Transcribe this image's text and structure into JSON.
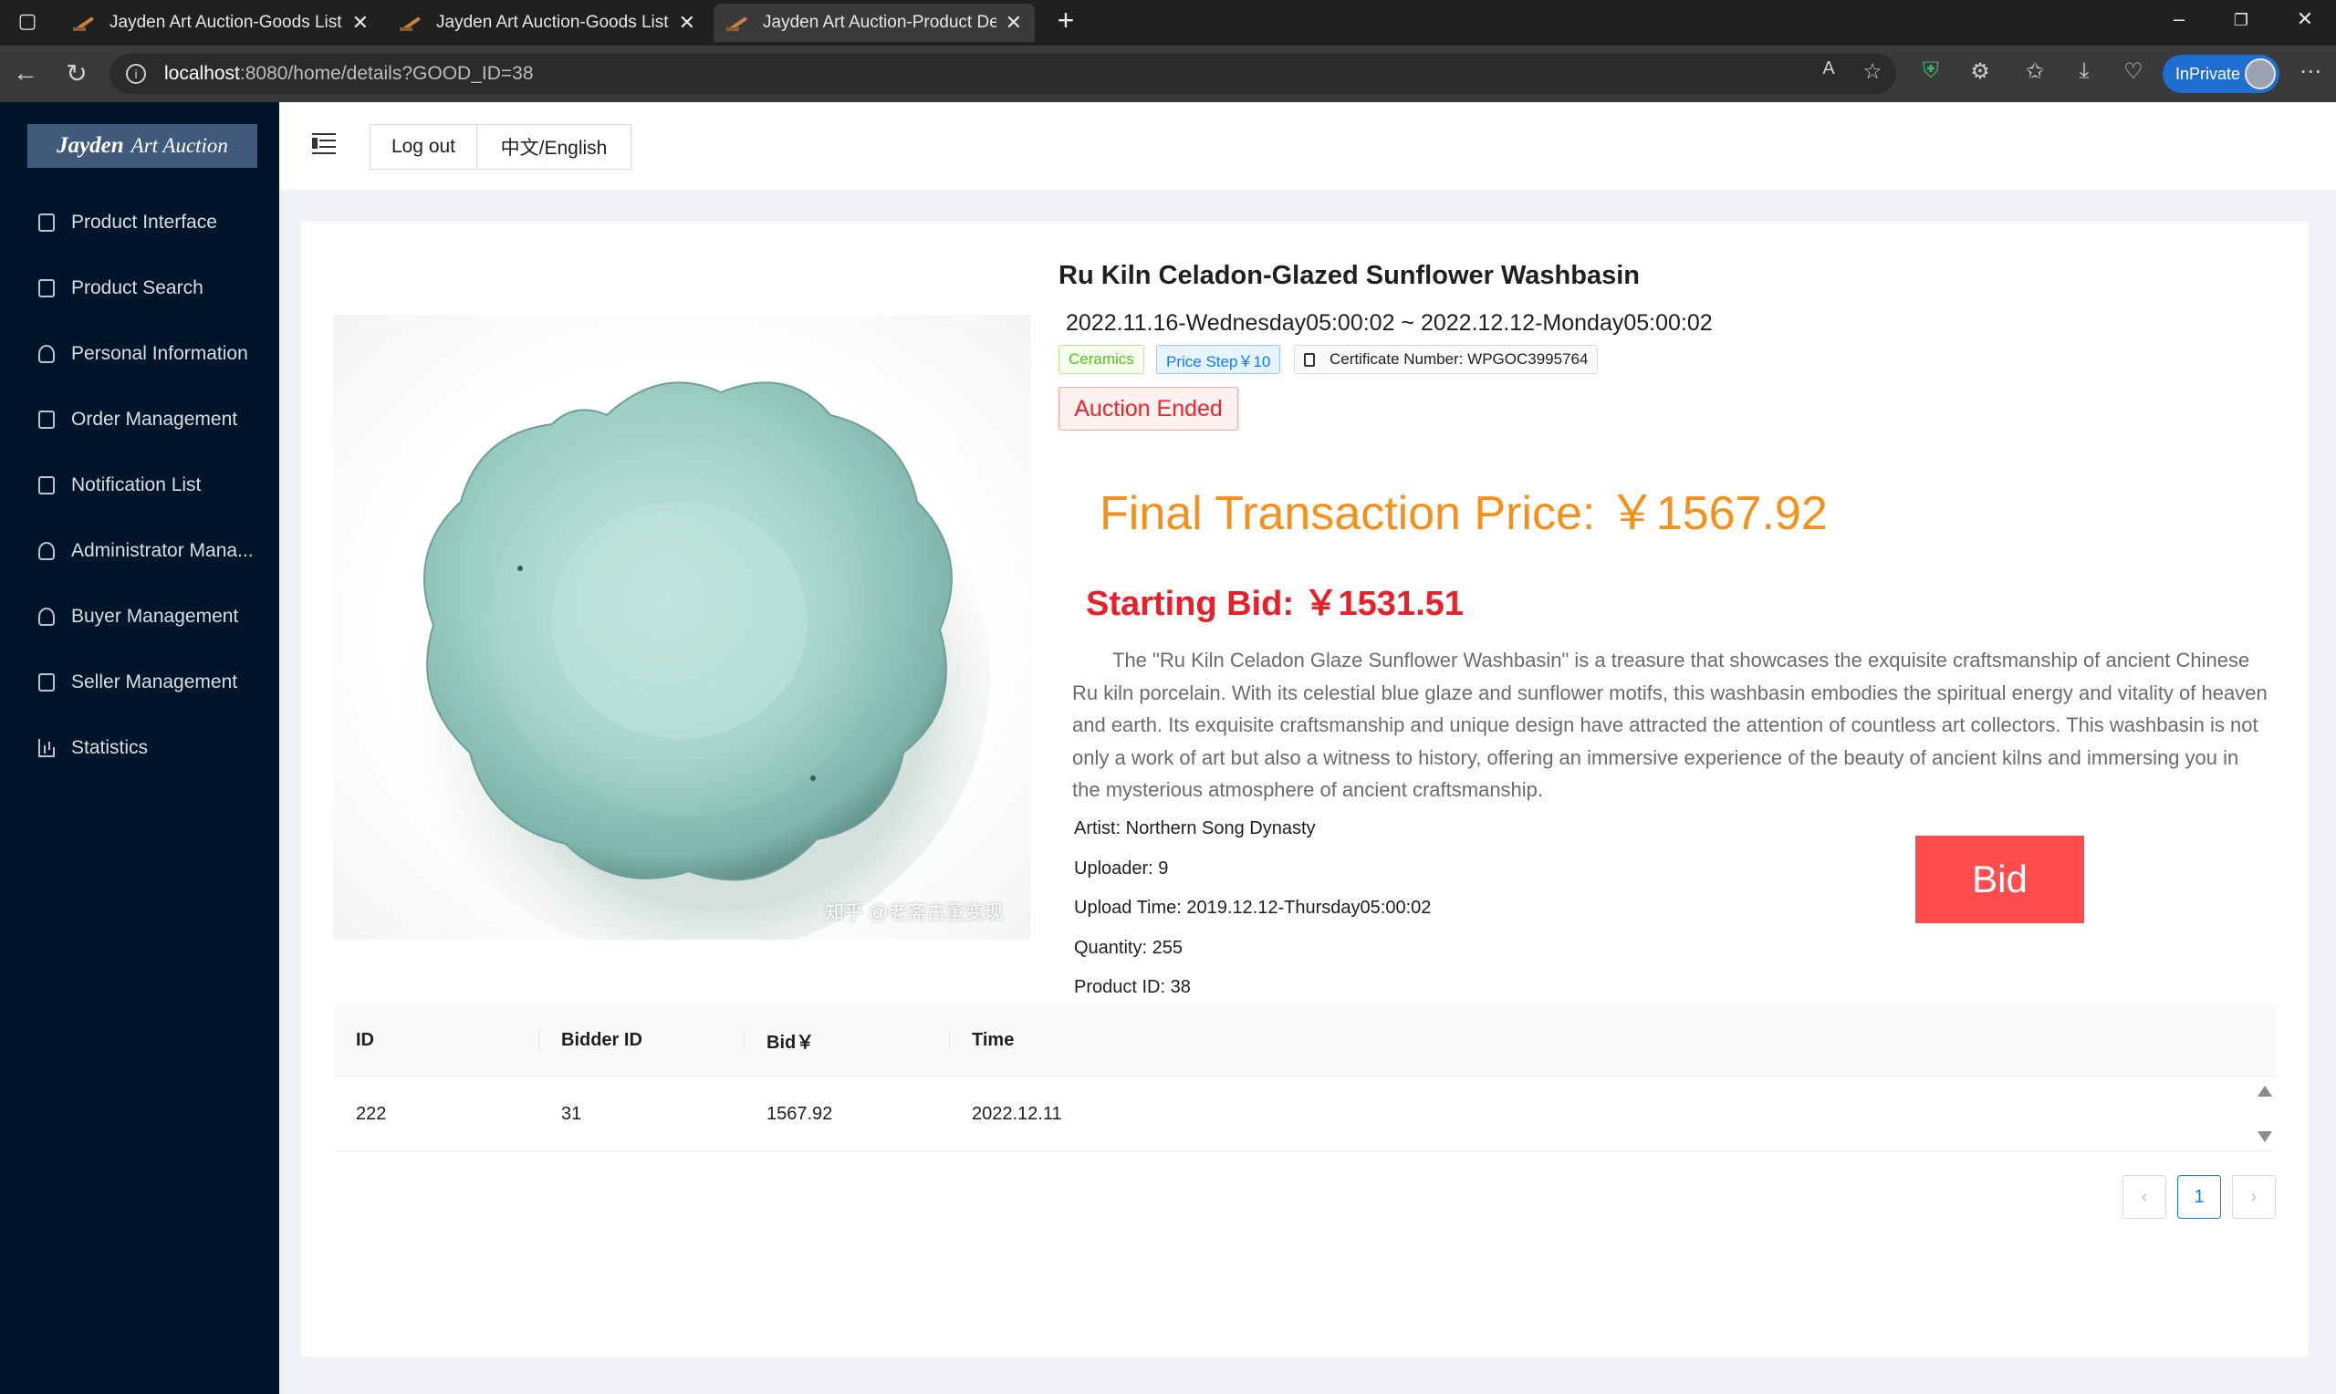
{
  "browser": {
    "tabs": [
      {
        "title": "Jayden Art Auction-Goods List",
        "active": false
      },
      {
        "title": "Jayden Art Auction-Goods List",
        "active": false
      },
      {
        "title": "Jayden Art Auction-Product Details",
        "active": true
      }
    ],
    "url_host": "localhost",
    "url_path": ":8080/home/details?GOOD_ID=38",
    "inprivate_label": "InPrivate"
  },
  "sidebar": {
    "logo_bold": "Jayden",
    "logo_rest": "Art Auction",
    "items": [
      {
        "label": "Product Interface",
        "icon": "shopping-bag-icon"
      },
      {
        "label": "Product Search",
        "icon": "search-file-icon"
      },
      {
        "label": "Personal Information",
        "icon": "user-icon"
      },
      {
        "label": "Order Management",
        "icon": "order-icon"
      },
      {
        "label": "Notification List",
        "icon": "document-icon"
      },
      {
        "label": "Administrator Mana...",
        "icon": "admin-user-icon"
      },
      {
        "label": "Buyer Management",
        "icon": "buyer-icon"
      },
      {
        "label": "Seller Management",
        "icon": "id-card-icon"
      },
      {
        "label": "Statistics",
        "icon": "bar-chart-icon"
      }
    ]
  },
  "header": {
    "logout_label": "Log out",
    "lang_label": "中文/English"
  },
  "product": {
    "title": "Ru Kiln Celadon-Glazed Sunflower Washbasin",
    "time_range": "2022.11.16-Wednesday05:00:02 ~ 2022.12.12-Monday05:00:02",
    "category_tag": "Ceramics",
    "price_step_tag": "Price Step￥10",
    "certificate_tag": "Certificate Number: WPGOC3995764",
    "status": "Auction Ended",
    "final_price": "Final Transaction Price: ￥1567.92",
    "starting_bid": "Starting Bid: ￥1531.51",
    "description": "The \"Ru Kiln Celadon Glaze Sunflower Washbasin\" is a treasure that showcases the exquisite craftsmanship of ancient Chinese Ru kiln porcelain. With its celestial blue glaze and sunflower motifs, this washbasin embodies the spiritual energy and vitality of heaven and earth. Its exquisite craftsmanship and unique design have attracted the attention of countless art collectors. This washbasin is not only a work of art but also a witness to history, offering an immersive experience of the beauty of ancient kilns and immersing you in the mysterious atmosphere of ancient craftsmanship.",
    "artist": "Artist: Northern Song Dynasty",
    "uploader": "Uploader: 9",
    "upload_time": "Upload Time: 2019.12.12-Thursday05:00:02",
    "quantity": "Quantity: 255",
    "product_id": "Product ID: 38",
    "bid_label": "Bid",
    "image_watermark": "知乎 @老斋古董变现"
  },
  "bids_table": {
    "columns": [
      "ID",
      "Bidder ID",
      "Bid￥",
      "Time"
    ],
    "rows": [
      [
        "222",
        "31",
        "1567.92",
        "2022.12.11"
      ]
    ]
  },
  "pagination": {
    "prev": "‹",
    "current": "1",
    "next": "›"
  },
  "colors": {
    "sidebar_bg": "#001529",
    "final_price": "#f5901a",
    "starting_bid": "#e8202a",
    "bid_button": "#ff4d4f",
    "ended_tag": "#f5222d"
  }
}
